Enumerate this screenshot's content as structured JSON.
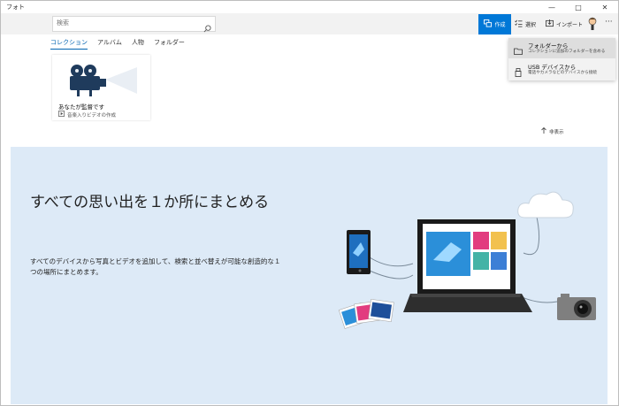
{
  "window": {
    "title": "フォト",
    "minimize": "—",
    "maximize": "□",
    "close": "✕"
  },
  "toolbar": {
    "search_placeholder": "検索",
    "create_label": "作成",
    "select_label": "選択",
    "import_label": "インポート",
    "more_label": "···"
  },
  "tabs": [
    {
      "label": "コレクション",
      "active": true
    },
    {
      "label": "アルバム",
      "active": false
    },
    {
      "label": "人物",
      "active": false
    },
    {
      "label": "フォルダー",
      "active": false
    }
  ],
  "card": {
    "title": "あなたが監督です",
    "subtitle": "音楽入りビデオの作成"
  },
  "hide_label": "非表示",
  "empty_state": {
    "headline": "すべての思い出を１か所にまとめる",
    "description": "すべてのデバイスから写真とビデオを追加して、検索と並べ替えが可能な創造的な１つの場所にまとめます。"
  },
  "import_menu": [
    {
      "label": "フォルダーから",
      "sub": "コレクションに追加のフォルダーを含める",
      "highlighted": true
    },
    {
      "label": "USB デバイスから",
      "sub": "電話やカメラなどのデバイスから接続",
      "highlighted": false
    }
  ],
  "colors": {
    "accent": "#0078d7",
    "panel_bg": "#ddeaf7",
    "command_bar": "#f2f2f2"
  }
}
